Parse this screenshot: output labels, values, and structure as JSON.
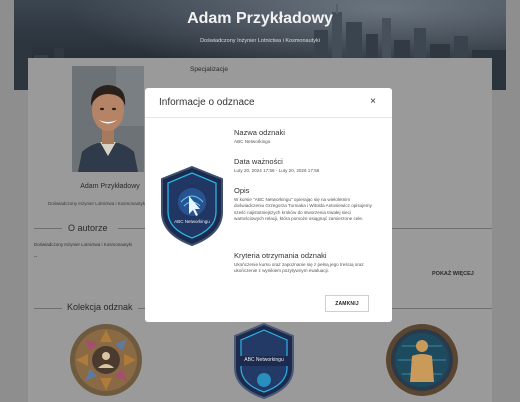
{
  "header": {
    "name": "Adam Przykładowy",
    "subtitle": "Doświadczony Inżynier Lotnictwa i Kosmonautyki"
  },
  "profile": {
    "name": "Adam Przykładowy",
    "role": "Doświadczony Inżynier Lotnictwa i Kosmonautyki",
    "avatar_icon": "avatar-photo"
  },
  "sections": {
    "specializations_title": "Specjalizacje",
    "about_title": "O autorze",
    "about_text": "Doświadczony Inżynier Lotnictwa i Kosmonautyki",
    "about_dash": "--",
    "show_more": "POKAŻ WIĘCEJ",
    "collection_title": "Kolekcja odznak"
  },
  "collection": {
    "badges": [
      {
        "icon": "network-people-badge-icon",
        "label": ""
      },
      {
        "icon": "abc-networking-shield-badge-icon",
        "label": "ABC Networkingu"
      },
      {
        "icon": "person-silhouette-badge-icon",
        "label": ""
      }
    ]
  },
  "modal": {
    "title": "Informacje o odznace",
    "close_symbol": "×",
    "badge_label": "ABC Networkingu",
    "name_heading": "Nazwa odznaki",
    "name_value": "ABC Networkingu",
    "validity_heading": "Data ważności",
    "validity_value": "Luty 20, 2024 17:56 - Luty 20, 2026 17:56",
    "description_heading": "Opis",
    "description_value": "W kursie \"ABC Networkingu\" opierając się na wieloletnim doświadczeniu Grzegorza Turniaka i Witolda Antosiewicz opisujemy sześć najistotniejszych kroków do stworzenia trwałej sieci wartościowych relacji, która pomoże osiągnąć zamierzone cele.",
    "criteria_heading": "Kryteria otrzymania odznaki",
    "criteria_value": "Ukończenie kursu oraz zapoznanie się z pełną jego treścią oraz ukończenie z wynikiem pozytywnym ewaluacji.",
    "close_button": "ZAMKNIJ"
  },
  "colors": {
    "overlay": "#8e8e8e",
    "modal_bg": "#ffffff",
    "badge_navy": "#1c2b4d",
    "badge_cyan": "#2bb3e6"
  }
}
